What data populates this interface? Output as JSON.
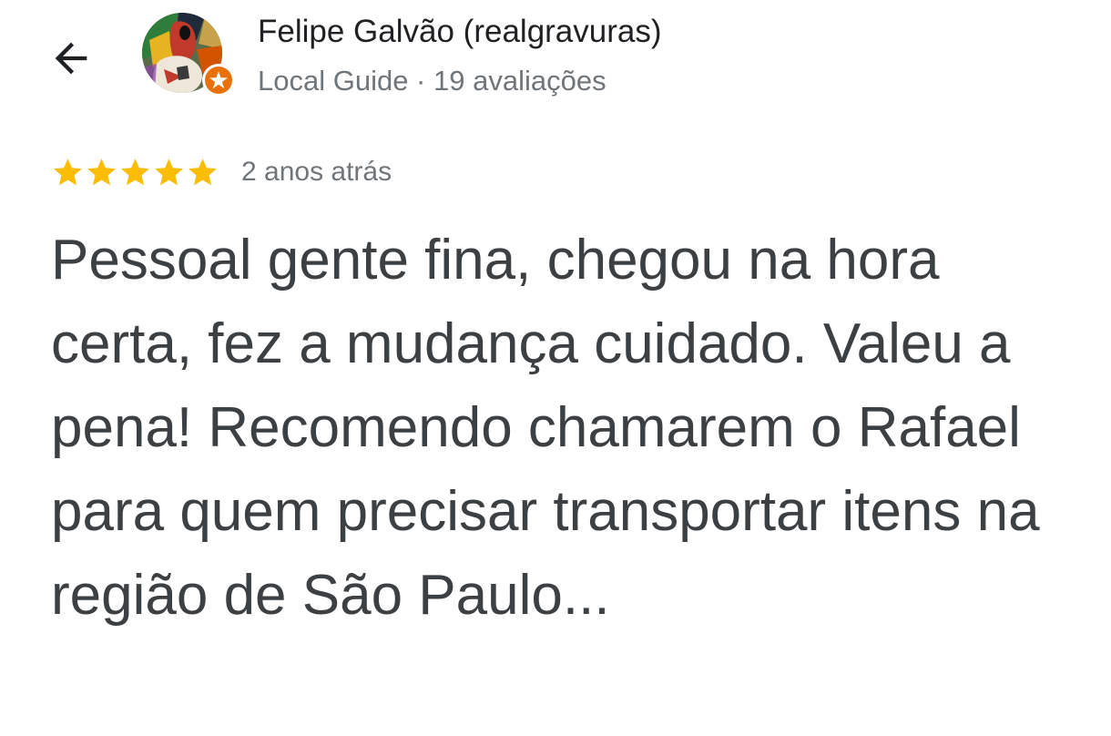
{
  "header": {
    "back_icon": "arrow-back-icon",
    "avatar_icon": "profile-avatar-artwork",
    "badge_icon": "local-guide-star-badge-icon",
    "name": "Felipe Galvão (realgravuras)",
    "meta": "Local Guide · 19 avaliações"
  },
  "review": {
    "rating": 5,
    "rating_max": 5,
    "star_color": "#fbbc04",
    "date": "2 anos atrás",
    "text": "Pessoal gente fina, chegou na hora certa, fez a mudança cuidado. Valeu a pena! Recomendo chamarem o Rafael para quem precisar transportar itens na região de São Paulo..."
  },
  "colors": {
    "badge": "#e8710a",
    "text": "#3c4043",
    "secondary_text": "#70757a"
  }
}
